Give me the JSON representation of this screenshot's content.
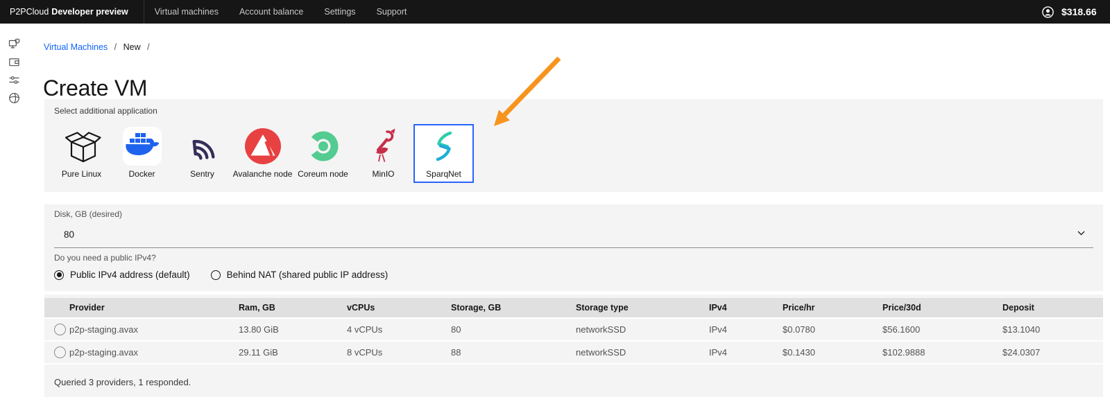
{
  "nav": {
    "brand": "P2PCloud",
    "brand_suffix": "Developer preview",
    "items": [
      "Virtual machines",
      "Account balance",
      "Settings",
      "Support"
    ],
    "balance": "$318.66"
  },
  "sidebar": {
    "items": [
      {
        "icon": "virtual-machines-icon"
      },
      {
        "icon": "wallet-icon"
      },
      {
        "icon": "settings-sliders-icon"
      },
      {
        "icon": "support-icon"
      }
    ]
  },
  "breadcrumb": {
    "link": "Virtual Machines",
    "separator": "/",
    "current": "New"
  },
  "page": {
    "title": "Create VM"
  },
  "apps": {
    "label": "Select additional application",
    "selected": "SparqNet",
    "items": [
      {
        "name": "Pure Linux",
        "icon": "pure-linux-box-icon"
      },
      {
        "name": "Docker",
        "icon": "docker-whale-icon"
      },
      {
        "name": "Sentry",
        "icon": "sentry-icon"
      },
      {
        "name": "Avalanche node",
        "icon": "avalanche-icon"
      },
      {
        "name": "Coreum node",
        "icon": "coreum-icon"
      },
      {
        "name": "MinIO",
        "icon": "minio-icon"
      },
      {
        "name": "SparqNet",
        "icon": "sparqnet-icon"
      }
    ]
  },
  "disk": {
    "label": "Disk, GB (desired)",
    "value": "80"
  },
  "ipv4": {
    "label": "Do you need a public IPv4?",
    "options": [
      {
        "label": "Public IPv4 address (default)",
        "selected": true
      },
      {
        "label": "Behind NAT (shared public IP address)",
        "selected": false
      }
    ]
  },
  "table": {
    "columns": [
      "Provider",
      "Ram, GB",
      "vCPUs",
      "Storage, GB",
      "Storage type",
      "IPv4",
      "Price/hr",
      "Price/30d",
      "Deposit"
    ],
    "rows": [
      {
        "provider": "p2p-staging.avax",
        "ram": "13.80 GiB",
        "vcpus": "4 vCPUs",
        "storage": "80",
        "storage_type": "networkSSD",
        "ipv4": "IPv4",
        "price_hr": "$0.0780",
        "price_30d": "$56.1600",
        "deposit": "$13.1040"
      },
      {
        "provider": "p2p-staging.avax",
        "ram": "29.11 GiB",
        "vcpus": "8 vCPUs",
        "storage": "88",
        "storage_type": "networkSSD",
        "ipv4": "IPv4",
        "price_hr": "$0.1430",
        "price_30d": "$102.9888",
        "deposit": "$24.0307"
      }
    ],
    "status": "Queried 3 providers, 1 responded."
  },
  "colors": {
    "nav_bg": "#161616",
    "panel_bg": "#f4f4f4",
    "table_header_bg": "#e0e0e0",
    "link_blue": "#0f62fe",
    "selection_border_blue": "#2962ff",
    "arrow_orange": "#F7941E",
    "docker_blue": "#1d63ed",
    "sentry_purple": "#362d59",
    "avalanche_red": "#e84142",
    "coreum_green": "#54cb90",
    "minio_red": "#c72e49",
    "sparqnet_teal": "#1fb6d0"
  }
}
